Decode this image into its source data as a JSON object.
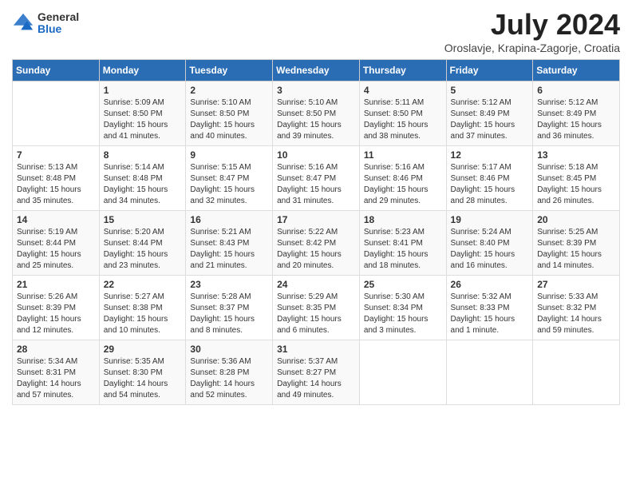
{
  "header": {
    "logo_general": "General",
    "logo_blue": "Blue",
    "title": "July 2024",
    "location": "Oroslavje, Krapina-Zagorje, Croatia"
  },
  "days_of_week": [
    "Sunday",
    "Monday",
    "Tuesday",
    "Wednesday",
    "Thursday",
    "Friday",
    "Saturday"
  ],
  "weeks": [
    [
      {
        "day": "",
        "info": ""
      },
      {
        "day": "1",
        "info": "Sunrise: 5:09 AM\nSunset: 8:50 PM\nDaylight: 15 hours\nand 41 minutes."
      },
      {
        "day": "2",
        "info": "Sunrise: 5:10 AM\nSunset: 8:50 PM\nDaylight: 15 hours\nand 40 minutes."
      },
      {
        "day": "3",
        "info": "Sunrise: 5:10 AM\nSunset: 8:50 PM\nDaylight: 15 hours\nand 39 minutes."
      },
      {
        "day": "4",
        "info": "Sunrise: 5:11 AM\nSunset: 8:50 PM\nDaylight: 15 hours\nand 38 minutes."
      },
      {
        "day": "5",
        "info": "Sunrise: 5:12 AM\nSunset: 8:49 PM\nDaylight: 15 hours\nand 37 minutes."
      },
      {
        "day": "6",
        "info": "Sunrise: 5:12 AM\nSunset: 8:49 PM\nDaylight: 15 hours\nand 36 minutes."
      }
    ],
    [
      {
        "day": "7",
        "info": "Sunrise: 5:13 AM\nSunset: 8:48 PM\nDaylight: 15 hours\nand 35 minutes."
      },
      {
        "day": "8",
        "info": "Sunrise: 5:14 AM\nSunset: 8:48 PM\nDaylight: 15 hours\nand 34 minutes."
      },
      {
        "day": "9",
        "info": "Sunrise: 5:15 AM\nSunset: 8:47 PM\nDaylight: 15 hours\nand 32 minutes."
      },
      {
        "day": "10",
        "info": "Sunrise: 5:16 AM\nSunset: 8:47 PM\nDaylight: 15 hours\nand 31 minutes."
      },
      {
        "day": "11",
        "info": "Sunrise: 5:16 AM\nSunset: 8:46 PM\nDaylight: 15 hours\nand 29 minutes."
      },
      {
        "day": "12",
        "info": "Sunrise: 5:17 AM\nSunset: 8:46 PM\nDaylight: 15 hours\nand 28 minutes."
      },
      {
        "day": "13",
        "info": "Sunrise: 5:18 AM\nSunset: 8:45 PM\nDaylight: 15 hours\nand 26 minutes."
      }
    ],
    [
      {
        "day": "14",
        "info": "Sunrise: 5:19 AM\nSunset: 8:44 PM\nDaylight: 15 hours\nand 25 minutes."
      },
      {
        "day": "15",
        "info": "Sunrise: 5:20 AM\nSunset: 8:44 PM\nDaylight: 15 hours\nand 23 minutes."
      },
      {
        "day": "16",
        "info": "Sunrise: 5:21 AM\nSunset: 8:43 PM\nDaylight: 15 hours\nand 21 minutes."
      },
      {
        "day": "17",
        "info": "Sunrise: 5:22 AM\nSunset: 8:42 PM\nDaylight: 15 hours\nand 20 minutes."
      },
      {
        "day": "18",
        "info": "Sunrise: 5:23 AM\nSunset: 8:41 PM\nDaylight: 15 hours\nand 18 minutes."
      },
      {
        "day": "19",
        "info": "Sunrise: 5:24 AM\nSunset: 8:40 PM\nDaylight: 15 hours\nand 16 minutes."
      },
      {
        "day": "20",
        "info": "Sunrise: 5:25 AM\nSunset: 8:39 PM\nDaylight: 15 hours\nand 14 minutes."
      }
    ],
    [
      {
        "day": "21",
        "info": "Sunrise: 5:26 AM\nSunset: 8:39 PM\nDaylight: 15 hours\nand 12 minutes."
      },
      {
        "day": "22",
        "info": "Sunrise: 5:27 AM\nSunset: 8:38 PM\nDaylight: 15 hours\nand 10 minutes."
      },
      {
        "day": "23",
        "info": "Sunrise: 5:28 AM\nSunset: 8:37 PM\nDaylight: 15 hours\nand 8 minutes."
      },
      {
        "day": "24",
        "info": "Sunrise: 5:29 AM\nSunset: 8:35 PM\nDaylight: 15 hours\nand 6 minutes."
      },
      {
        "day": "25",
        "info": "Sunrise: 5:30 AM\nSunset: 8:34 PM\nDaylight: 15 hours\nand 3 minutes."
      },
      {
        "day": "26",
        "info": "Sunrise: 5:32 AM\nSunset: 8:33 PM\nDaylight: 15 hours\nand 1 minute."
      },
      {
        "day": "27",
        "info": "Sunrise: 5:33 AM\nSunset: 8:32 PM\nDaylight: 14 hours\nand 59 minutes."
      }
    ],
    [
      {
        "day": "28",
        "info": "Sunrise: 5:34 AM\nSunset: 8:31 PM\nDaylight: 14 hours\nand 57 minutes."
      },
      {
        "day": "29",
        "info": "Sunrise: 5:35 AM\nSunset: 8:30 PM\nDaylight: 14 hours\nand 54 minutes."
      },
      {
        "day": "30",
        "info": "Sunrise: 5:36 AM\nSunset: 8:28 PM\nDaylight: 14 hours\nand 52 minutes."
      },
      {
        "day": "31",
        "info": "Sunrise: 5:37 AM\nSunset: 8:27 PM\nDaylight: 14 hours\nand 49 minutes."
      },
      {
        "day": "",
        "info": ""
      },
      {
        "day": "",
        "info": ""
      },
      {
        "day": "",
        "info": ""
      }
    ]
  ]
}
